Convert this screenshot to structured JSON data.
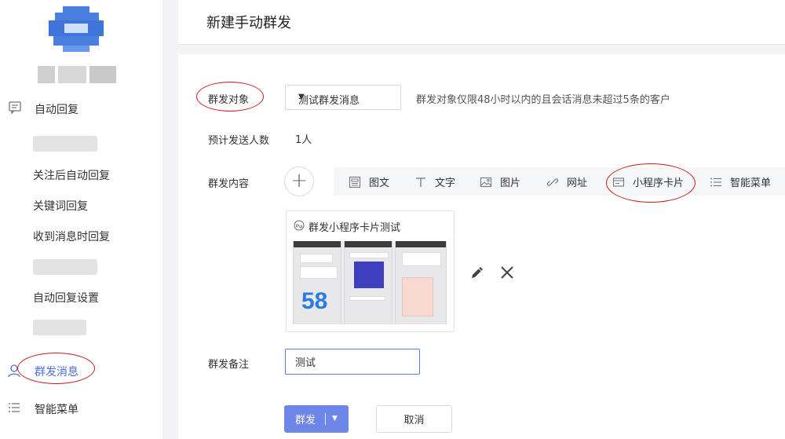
{
  "header": {
    "title": "新建手动群发"
  },
  "sidebar": {
    "items": [
      {
        "label": "自动回复",
        "icon": "chat-icon"
      },
      {
        "label": "关注后自动回复"
      },
      {
        "label": "关键词回复"
      },
      {
        "label": "收到消息时回复"
      },
      {
        "label": "自动回复设置"
      },
      {
        "label": "群发消息",
        "icon": "user-icon",
        "active": true
      },
      {
        "label": "智能菜单",
        "icon": "list-icon"
      }
    ]
  },
  "form": {
    "target_label": "群发对象",
    "target_value": "测试群发消息",
    "target_hint": "群发对象仅限48小时以内的且会话消息未超过5条的客户",
    "count_label": "预计发送人数",
    "count_value": "1人",
    "content_label": "群发内容",
    "toolbar": [
      {
        "label": "图文",
        "icon": "article-icon"
      },
      {
        "label": "文字",
        "icon": "text-icon"
      },
      {
        "label": "图片",
        "icon": "image-icon"
      },
      {
        "label": "网址",
        "icon": "link-icon"
      },
      {
        "label": "小程序卡片",
        "icon": "miniprogram-card-icon"
      },
      {
        "label": "智能菜单",
        "icon": "list-icon"
      }
    ],
    "card_title": "群发小程序卡片测试",
    "thumb_text": "58",
    "remark_label": "群发备注",
    "remark_value": "测试",
    "send_label": "群发",
    "cancel_label": "取消"
  },
  "colors": {
    "accent": "#6f86e9",
    "annotation": "#cc1b1b",
    "active_nav": "#4a6fe0"
  }
}
